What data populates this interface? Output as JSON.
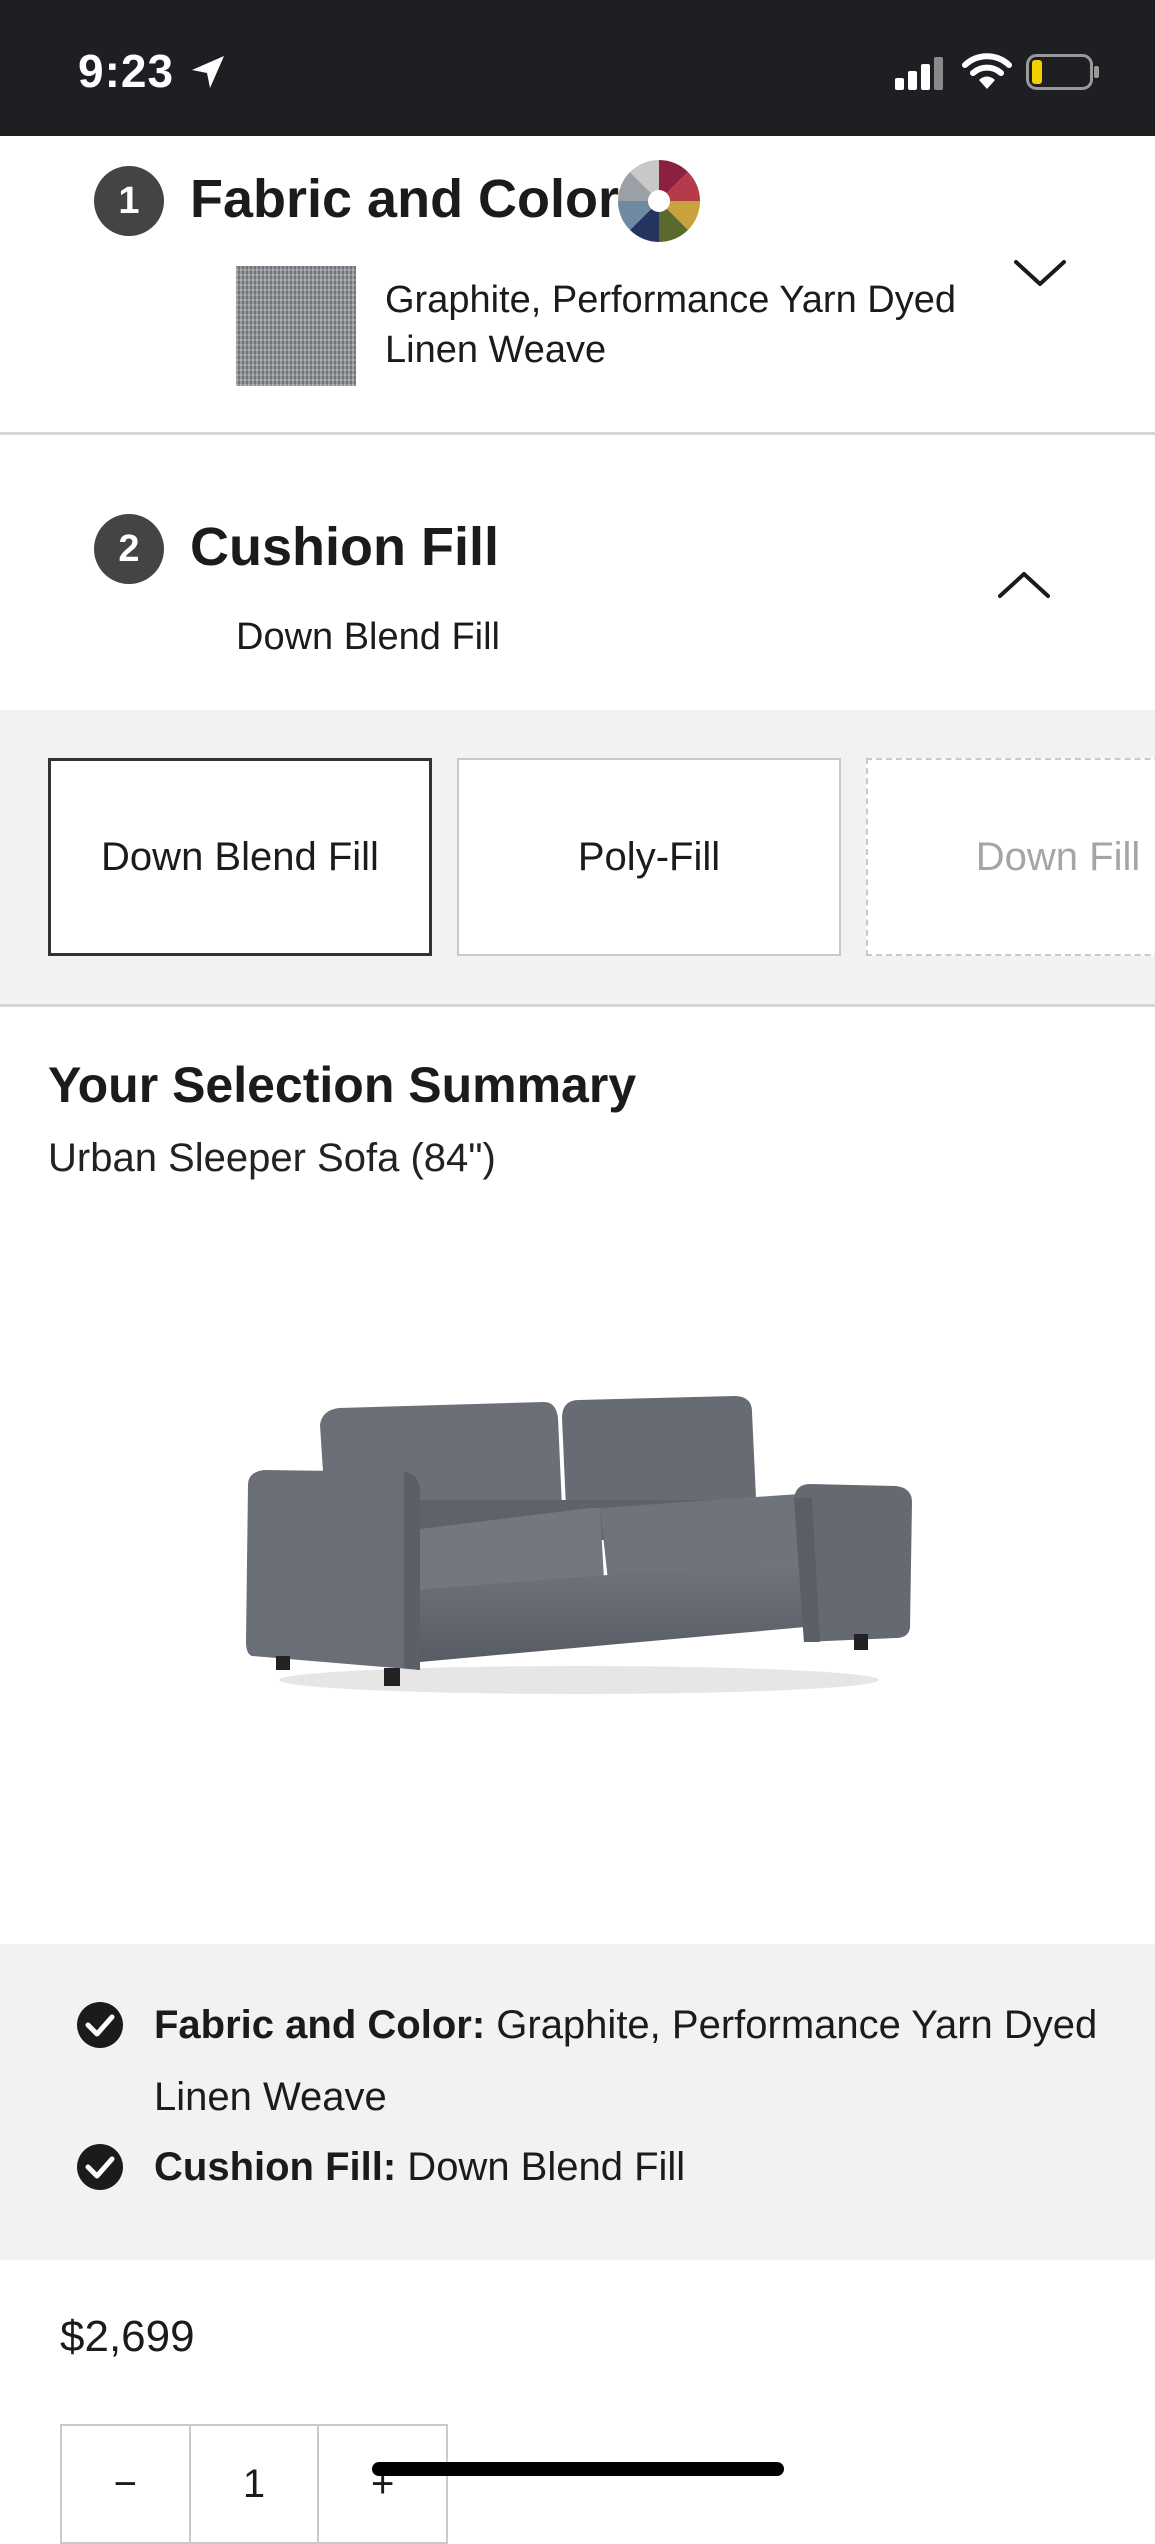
{
  "status_bar": {
    "time": "9:23"
  },
  "sections": {
    "fabric": {
      "number": "1",
      "title": "Fabric and Color",
      "selection_line1": "Graphite, Performance Yarn Dyed",
      "selection_line2": "Linen Weave"
    },
    "cushion": {
      "number": "2",
      "title": "Cushion Fill",
      "selection": "Down Blend Fill"
    }
  },
  "fill_options": [
    {
      "label": "Down Blend Fill",
      "state": "selected"
    },
    {
      "label": "Poly-Fill",
      "state": "available"
    },
    {
      "label": "Down Fill",
      "state": "unavailable"
    }
  ],
  "summary": {
    "title": "Your Selection Summary",
    "product": "Urban Sleeper Sofa (84\")",
    "specs": [
      {
        "label": "Fabric and Color:",
        "value": " Graphite, Performance Yarn Dyed",
        "value_cont": "Linen Weave"
      },
      {
        "label": "Cushion Fill:",
        "value": " Down Blend Fill"
      }
    ]
  },
  "price": "$2,699",
  "quantity": {
    "minus": "−",
    "value": "1",
    "plus": "+"
  },
  "colors": {
    "sofa": "#646871",
    "dark_bar": "#1e1f22",
    "battery_level": "#f5d000"
  }
}
